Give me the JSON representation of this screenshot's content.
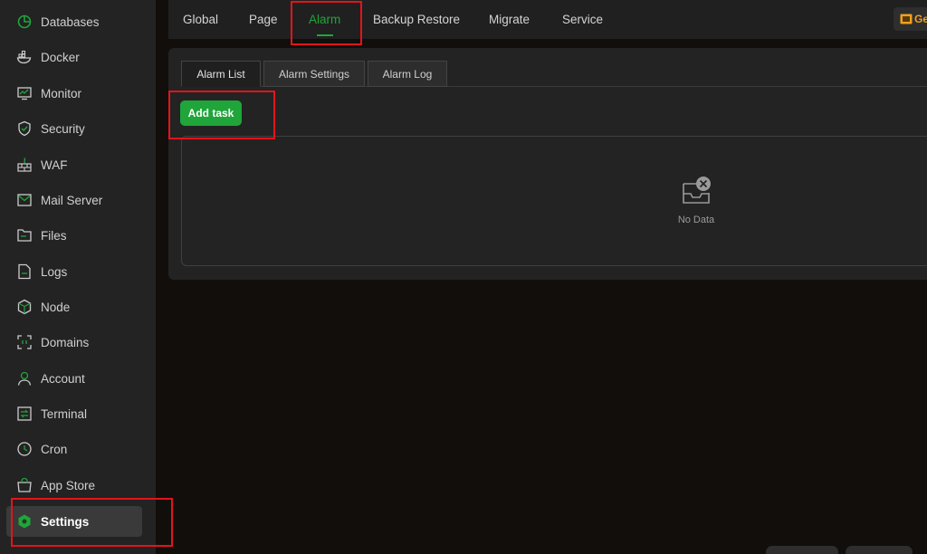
{
  "sidebar": {
    "items": [
      {
        "label": "Databases",
        "icon": "database-icon"
      },
      {
        "label": "Docker",
        "icon": "docker-icon"
      },
      {
        "label": "Monitor",
        "icon": "monitor-icon"
      },
      {
        "label": "Security",
        "icon": "shield-icon"
      },
      {
        "label": "WAF",
        "icon": "firewall-icon"
      },
      {
        "label": "Mail Server",
        "icon": "mail-icon"
      },
      {
        "label": "Files",
        "icon": "folder-icon"
      },
      {
        "label": "Logs",
        "icon": "log-icon"
      },
      {
        "label": "Node",
        "icon": "node-cube-icon"
      },
      {
        "label": "Domains",
        "icon": "domain-icon"
      },
      {
        "label": "Account",
        "icon": "user-icon"
      },
      {
        "label": "Terminal",
        "icon": "terminal-icon"
      },
      {
        "label": "Cron",
        "icon": "clock-icon"
      },
      {
        "label": "App Store",
        "icon": "app-store-icon"
      },
      {
        "label": "Settings",
        "icon": "settings-icon"
      }
    ],
    "active": "Settings"
  },
  "topnav": {
    "tabs": [
      "Global",
      "Page",
      "Alarm",
      "Backup Restore",
      "Migrate",
      "Service"
    ],
    "active": "Alarm",
    "upgrade_label": "Ge"
  },
  "alarm": {
    "subtabs": [
      "Alarm List",
      "Alarm Settings",
      "Alarm Log"
    ],
    "active_subtab": "Alarm List",
    "add_button": "Add task",
    "empty_text": "No Data"
  },
  "colors": {
    "accent": "#20a53a",
    "highlight_box": "#e3141b",
    "upgrade": "#f0a020"
  }
}
